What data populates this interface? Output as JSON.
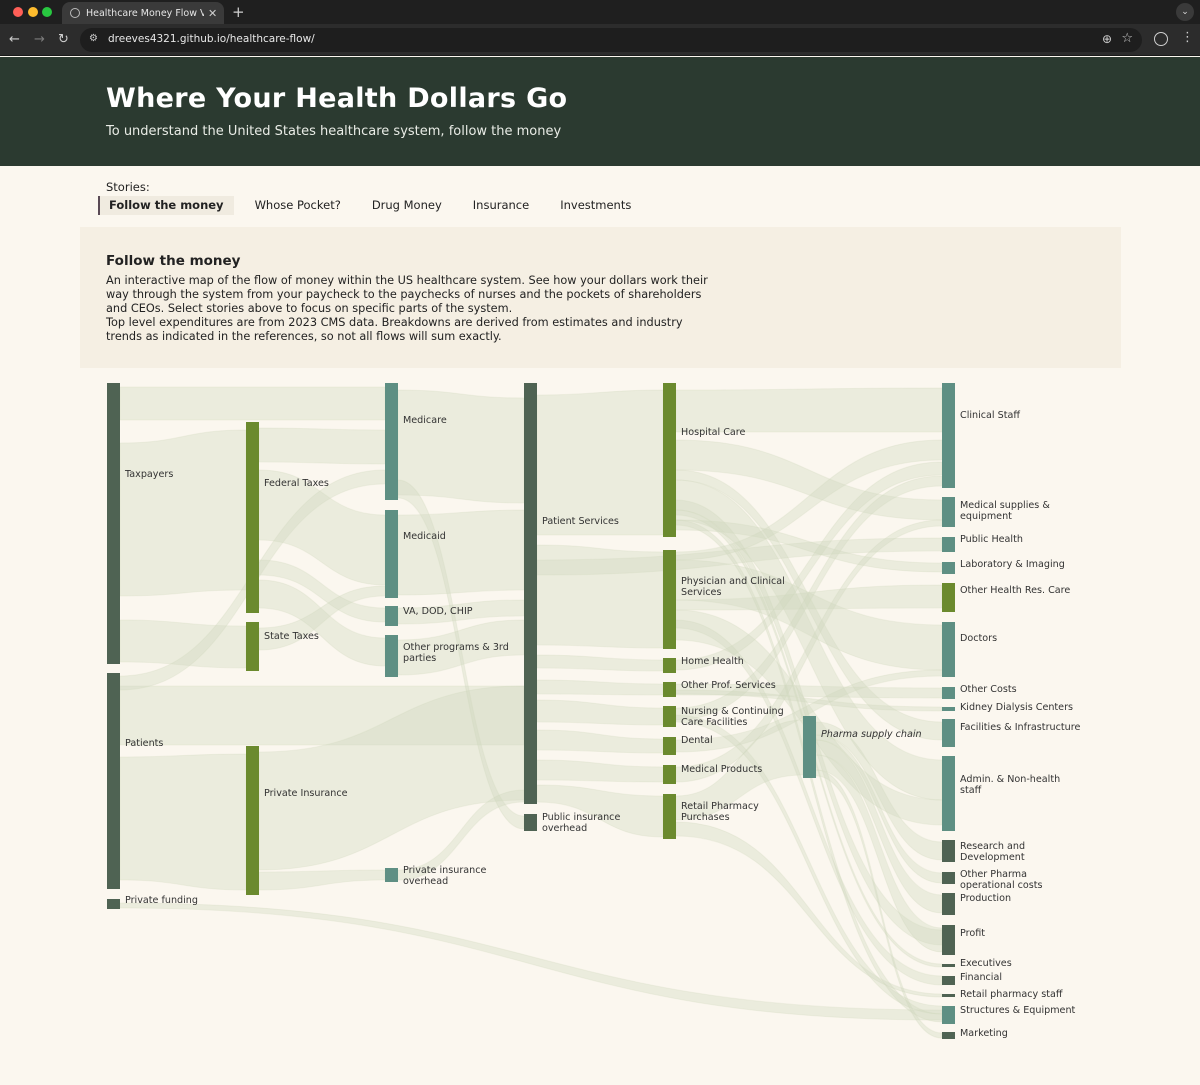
{
  "browser": {
    "tab_title": "Healthcare Money Flow Visua",
    "url": "dreeves4321.github.io/healthcare-flow/"
  },
  "hero": {
    "title": "Where Your Health Dollars Go",
    "subtitle": "To understand the United States healthcare system, follow the money"
  },
  "stories": {
    "label": "Stories:",
    "tabs": [
      "Follow the money",
      "Whose Pocket?",
      "Drug Money",
      "Insurance",
      "Investments"
    ],
    "active": 0
  },
  "intro": {
    "title": "Follow the money",
    "paragraph1": "An interactive map of the flow of money within the US healthcare system. See how your dollars work their way through the system from your paycheck to the paychecks of nurses and the pockets of shareholders and CEOs. Select stories above to focus on specific parts of the system.",
    "paragraph2": "Top level expenditures are from 2023 CMS data. Breakdowns are derived from estimates and industry trends as indicated in the references, so not all flows will sum exactly."
  },
  "colors": {
    "source_node": "#4f6353",
    "tax_node": "#6b8a2e",
    "program_node": "#5e8f83",
    "link": "#cfd6bd"
  },
  "sankey": {
    "nodes": [
      {
        "id": "taxpayers",
        "label": "Taxpayers",
        "kind": "source"
      },
      {
        "id": "patients",
        "label": "Patients",
        "kind": "source"
      },
      {
        "id": "private_funding",
        "label": "Private funding",
        "kind": "source"
      },
      {
        "id": "federal_taxes",
        "label": "Federal Taxes",
        "kind": "tax"
      },
      {
        "id": "state_taxes",
        "label": "State Taxes",
        "kind": "tax"
      },
      {
        "id": "private_insurance",
        "label": "Private Insurance",
        "kind": "tax"
      },
      {
        "id": "medicare",
        "label": "Medicare",
        "kind": "program"
      },
      {
        "id": "medicaid",
        "label": "Medicaid",
        "kind": "program"
      },
      {
        "id": "va_dod",
        "label": "VA, DOD, CHIP",
        "kind": "program"
      },
      {
        "id": "other_programs",
        "label": "Other programs & 3rd parties",
        "kind": "program"
      },
      {
        "id": "private_ins_overhead",
        "label": "Private insurance overhead",
        "kind": "program"
      },
      {
        "id": "patient_services",
        "label": "Patient Services",
        "kind": "source"
      },
      {
        "id": "public_ins_overhead",
        "label": "Public insurance overhead",
        "kind": "source"
      },
      {
        "id": "hospital_care",
        "label": "Hospital Care",
        "kind": "tax"
      },
      {
        "id": "physician",
        "label": "Physician and Clinical Services",
        "kind": "tax"
      },
      {
        "id": "home_health",
        "label": "Home Health",
        "kind": "tax"
      },
      {
        "id": "other_prof",
        "label": "Other Prof. Services",
        "kind": "tax"
      },
      {
        "id": "nursing",
        "label": "Nursing & Continuing Care Facilities",
        "kind": "tax"
      },
      {
        "id": "dental",
        "label": "Dental",
        "kind": "tax"
      },
      {
        "id": "medical_products",
        "label": "Medical Products",
        "kind": "tax"
      },
      {
        "id": "retail_pharmacy",
        "label": "Retail Pharmacy Purchases",
        "kind": "tax"
      },
      {
        "id": "pharma_supply",
        "label": "Pharma supply chain",
        "kind": "program",
        "italic": true
      },
      {
        "id": "clinical_staff",
        "label": "Clinical Staff",
        "kind": "program"
      },
      {
        "id": "med_supplies",
        "label": "Medical supplies & equipment",
        "kind": "program"
      },
      {
        "id": "public_health",
        "label": "Public Health",
        "kind": "program"
      },
      {
        "id": "lab_imaging",
        "label": "Laboratory & Imaging",
        "kind": "program"
      },
      {
        "id": "other_health_res",
        "label": "Other Health Res. Care",
        "kind": "tax"
      },
      {
        "id": "doctors",
        "label": "Doctors",
        "kind": "program"
      },
      {
        "id": "other_costs",
        "label": "Other Costs",
        "kind": "program"
      },
      {
        "id": "kidney",
        "label": "Kidney Dialysis Centers",
        "kind": "program"
      },
      {
        "id": "facilities",
        "label": "Facilities & Infrastructure",
        "kind": "program"
      },
      {
        "id": "admin",
        "label": "Admin. & Non-health staff",
        "kind": "program"
      },
      {
        "id": "rnd",
        "label": "Research and Development",
        "kind": "source"
      },
      {
        "id": "other_pharma",
        "label": "Other Pharma operational costs",
        "kind": "source"
      },
      {
        "id": "production",
        "label": "Production",
        "kind": "source"
      },
      {
        "id": "profit",
        "label": "Profit",
        "kind": "source"
      },
      {
        "id": "executives",
        "label": "Executives",
        "kind": "source"
      },
      {
        "id": "financial",
        "label": "Financial",
        "kind": "source"
      },
      {
        "id": "retail_staff",
        "label": "Retail pharmacy staff",
        "kind": "source"
      },
      {
        "id": "structures",
        "label": "Structures & Equipment",
        "kind": "program"
      },
      {
        "id": "marketing",
        "label": "Marketing",
        "kind": "source"
      }
    ]
  }
}
